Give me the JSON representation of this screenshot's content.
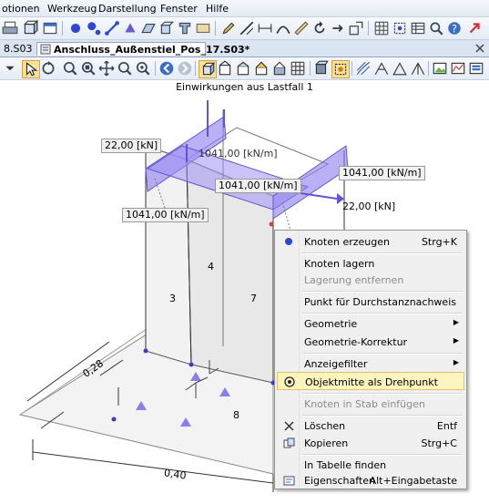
{
  "menu": {
    "items": [
      "otionen",
      "Werkzeug",
      "Darstellung",
      "Fenster",
      "Hilfe"
    ]
  },
  "tabs": [
    {
      "label": "8.S03"
    },
    {
      "label": "Anschluss_Außenstiel_Pos_17.S03*"
    }
  ],
  "view": {
    "caption": "Einwirkungen aus Lastfall 1"
  },
  "model": {
    "loads": {
      "force_left": "22,00 [kN]",
      "line_top": "1041,00 [kN/m]",
      "line_right": "1041,00 [kN/m]",
      "line_mid": "1041,00 [kN/m]",
      "line_left": "1041,00 [kN/m]",
      "force_right": "22,00 [kN]"
    },
    "members": {
      "m3": "3",
      "m4": "4",
      "m7": "7",
      "m8": "8"
    },
    "dimensions": {
      "depth": "0,28",
      "width": "0,40"
    }
  },
  "context_menu": {
    "items": [
      {
        "label": "Knoten erzeugen",
        "shortcut": "Strg+K",
        "icon": "blue-dot-icon"
      },
      {
        "label": "Knoten lagern"
      },
      {
        "label": "Lagerung entfernen",
        "disabled": true
      },
      {
        "label": "Punkt für Durchstanznachweis"
      },
      {
        "label": "Geometrie",
        "submenu": true
      },
      {
        "label": "Geometrie-Korrektur",
        "submenu": true
      },
      {
        "label": "Anzeigefilter",
        "submenu": true
      },
      {
        "label": "Objektmitte als Drehpunkt",
        "icon": "target-icon",
        "highlighted": true
      },
      {
        "label": "Knoten in Stab einfügen",
        "disabled": true
      },
      {
        "label": "Löschen",
        "shortcut": "Entf",
        "icon": "x-delete-icon"
      },
      {
        "label": "Kopieren",
        "shortcut": "Strg+C",
        "icon": "copy-icon"
      },
      {
        "label": "In Tabelle finden"
      },
      {
        "label": "Eigenschaften",
        "shortcut": "Alt+Eingabetaste",
        "icon": "properties-icon"
      }
    ]
  },
  "colors": {
    "load": "#7b68ee",
    "highlight": "#fdf4bf",
    "node": "#3a3ad0"
  }
}
